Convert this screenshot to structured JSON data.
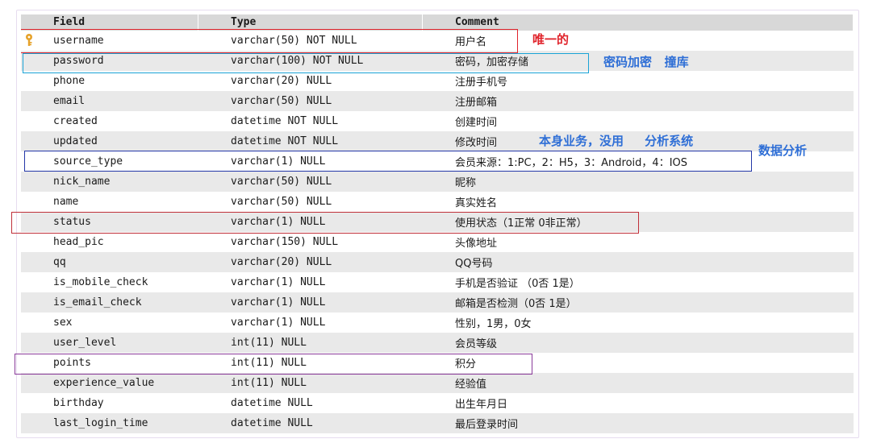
{
  "table": {
    "headers": {
      "field": "Field",
      "type": "Type",
      "comment": "Comment"
    },
    "rows": [
      {
        "field": "username",
        "type": "varchar(50) NOT NULL",
        "comment": "用户名",
        "primary_key": true
      },
      {
        "field": "password",
        "type": "varchar(100) NOT NULL",
        "comment": "密码，加密存储"
      },
      {
        "field": "phone",
        "type": "varchar(20) NULL",
        "comment": "注册手机号"
      },
      {
        "field": "email",
        "type": "varchar(50) NULL",
        "comment": "注册邮箱"
      },
      {
        "field": "created",
        "type": "datetime NOT NULL",
        "comment": "创建时间"
      },
      {
        "field": "updated",
        "type": "datetime NOT NULL",
        "comment": "修改时间"
      },
      {
        "field": "source_type",
        "type": "varchar(1) NULL",
        "comment": "会员来源：1:PC，2：H5，3：Android，4：IOS"
      },
      {
        "field": "nick_name",
        "type": "varchar(50) NULL",
        "comment": "昵称"
      },
      {
        "field": "name",
        "type": "varchar(50) NULL",
        "comment": "真实姓名"
      },
      {
        "field": "status",
        "type": "varchar(1) NULL",
        "comment": "使用状态（1正常 0非正常）"
      },
      {
        "field": "head_pic",
        "type": "varchar(150) NULL",
        "comment": "头像地址"
      },
      {
        "field": "qq",
        "type": "varchar(20) NULL",
        "comment": "QQ号码"
      },
      {
        "field": "is_mobile_check",
        "type": "varchar(1) NULL",
        "comment": "手机是否验证 （0否 1是）"
      },
      {
        "field": "is_email_check",
        "type": "varchar(1) NULL",
        "comment": "邮箱是否检测（0否 1是）"
      },
      {
        "field": "sex",
        "type": "varchar(1) NULL",
        "comment": "性别，1男，0女"
      },
      {
        "field": "user_level",
        "type": "int(11) NULL",
        "comment": "会员等级"
      },
      {
        "field": "points",
        "type": "int(11) NULL",
        "comment": "积分"
      },
      {
        "field": "experience_value",
        "type": "int(11) NULL",
        "comment": "经验值"
      },
      {
        "field": "birthday",
        "type": "datetime NULL",
        "comment": "出生年月日"
      },
      {
        "field": "last_login_time",
        "type": "datetime NULL",
        "comment": "最后登录时间"
      }
    ]
  },
  "annotations": {
    "unique": "唯一的",
    "password_note": "密码加密   撞库",
    "source_note_1": "本身业务，没用     分析系统",
    "source_note_2": "数据分析"
  },
  "colors": {
    "red": "#e0232b",
    "blue": "#2f6fd6",
    "cyan_box": "#1aa3d6",
    "purple_box": "#8a3a9a",
    "navy_box": "#2438a8",
    "key_gold": "#e6a22a"
  },
  "icons": {
    "primary_key": "key-icon"
  }
}
